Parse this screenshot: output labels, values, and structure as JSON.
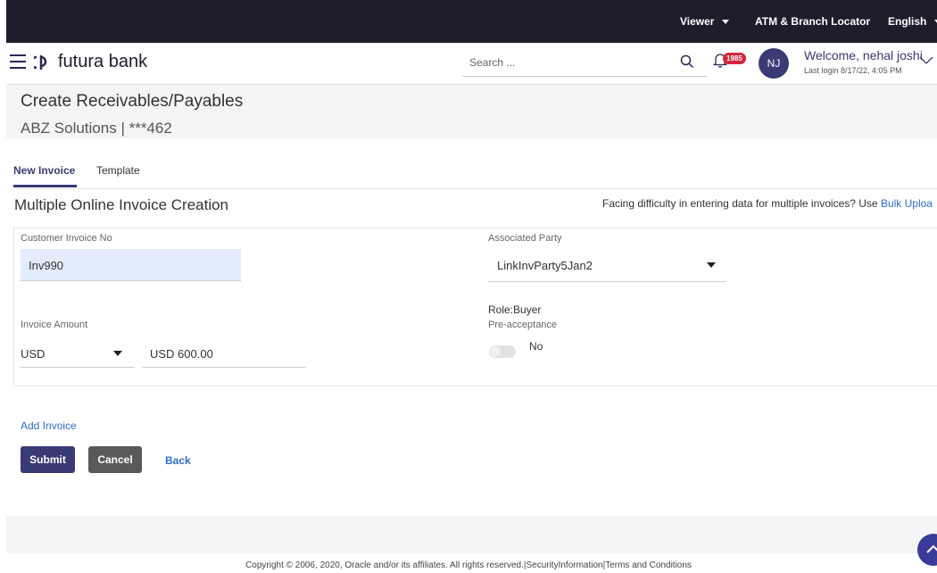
{
  "topbar": {
    "viewer": "Viewer",
    "atm_locator": "ATM & Branch Locator",
    "language": "English"
  },
  "header": {
    "logo_text": "futura bank",
    "search_placeholder": "Search ...",
    "notification_count": "1985",
    "avatar_initials": "NJ",
    "welcome": "Welcome, nehal joshi",
    "last_login": "Last login 8/17/22, 4:05 PM"
  },
  "page": {
    "title": "Create Receivables/Payables",
    "subtitle": "ABZ Solutions | ***462"
  },
  "tabs": [
    {
      "label": "New Invoice",
      "active": true
    },
    {
      "label": "Template",
      "active": false
    }
  ],
  "section": {
    "title": "Multiple Online Invoice Creation",
    "help_text": "Facing difficulty in entering data for multiple invoices? Use ",
    "help_link": "Bulk Uploa"
  },
  "form": {
    "customer_invoice_label": "Customer Invoice No",
    "customer_invoice_value": "Inv990",
    "associated_party_label": "Associated Party",
    "associated_party_value": "LinkInvParty5Jan2",
    "invoice_amount_label": "Invoice Amount",
    "currency_value": "USD",
    "amount_value": "USD 600.00",
    "role_text": "Role:Buyer",
    "preacceptance_label": "Pre-acceptance",
    "preacceptance_value": "No"
  },
  "actions": {
    "add_invoice": "Add Invoice",
    "submit": "Submit",
    "cancel": "Cancel",
    "back": "Back"
  },
  "footer": {
    "copyright": "Copyright © 2006, 2020, Oracle and/or its affiliates. All rights reserved.|SecurityInformation|Terms and Conditions"
  },
  "colors": {
    "topbar_bg": "#1d1d2b",
    "primary": "#3a3a76",
    "link": "#2c6fc4",
    "badge": "#d6263b",
    "input_bg": "#e3ecfb"
  }
}
